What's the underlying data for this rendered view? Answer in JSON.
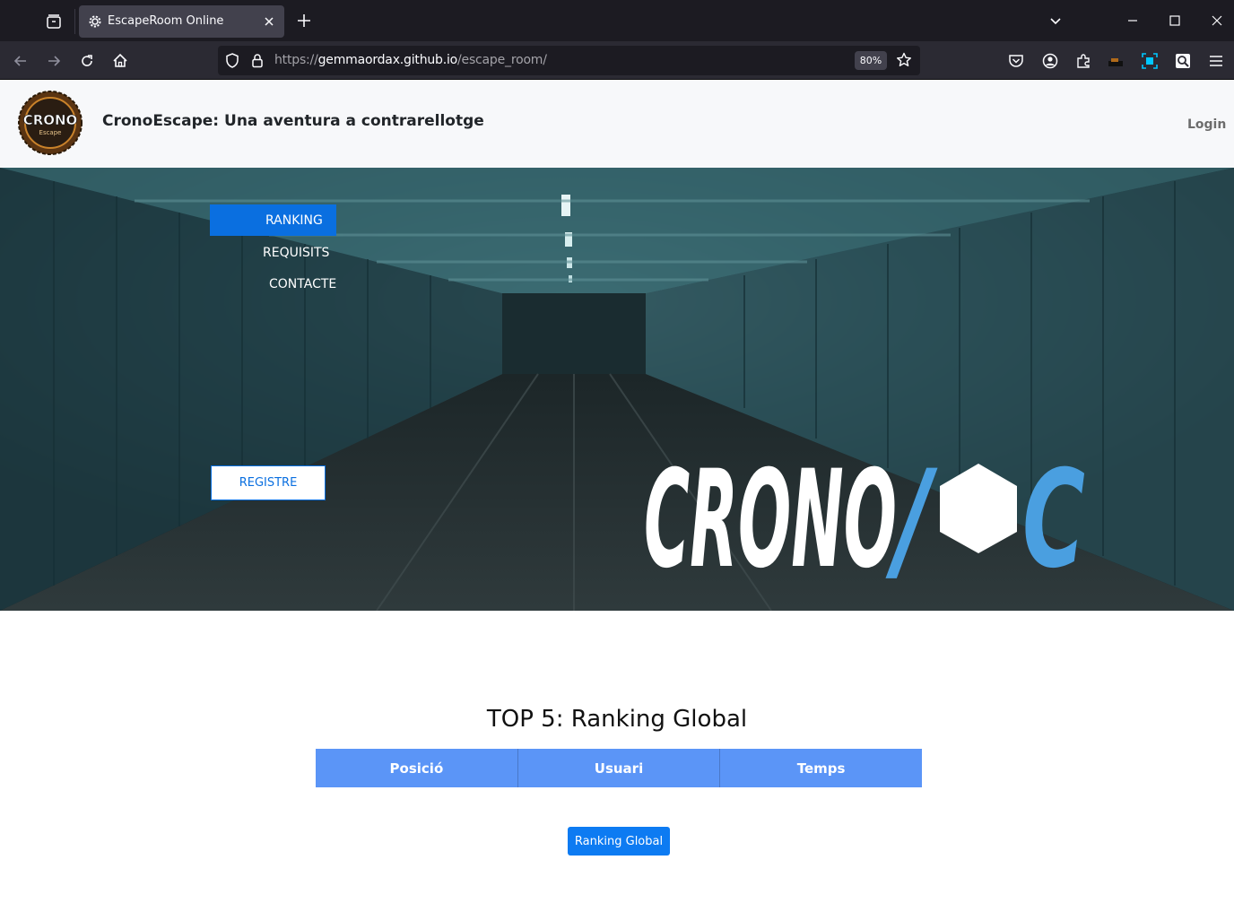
{
  "browser": {
    "tab": {
      "title": "EscapeRoom Online",
      "favicon": "gear-icon"
    },
    "url": {
      "scheme": "https://",
      "host": "gemmaordax.github.io",
      "path": "/escape_room/"
    },
    "zoom": "80%",
    "icons": [
      "tab-list-icon",
      "close-icon",
      "plus-icon",
      "chevron-down-icon",
      "minimize-icon",
      "maximize-icon",
      "window-close-icon",
      "back-icon",
      "forward-icon",
      "reload-icon",
      "home-icon",
      "shield-icon",
      "lock-icon",
      "star-icon",
      "pocket-icon",
      "account-icon",
      "extensions-icon",
      "screenshot-icon",
      "menu-icon"
    ]
  },
  "header": {
    "logo_text": "CRONO",
    "logo_sub": "Escape",
    "title": "CronoEscape: Una aventura a contrarellotge",
    "login": "Login"
  },
  "hero": {
    "menu": [
      {
        "label": "RANKING",
        "active": true
      },
      {
        "label": "REQUISITS",
        "active": false
      },
      {
        "label": "CONTACTE",
        "active": false
      }
    ],
    "register_button": "REGISTRE",
    "brand": {
      "left": "CRONO",
      "slash": "/",
      "right": "C"
    }
  },
  "ranking": {
    "title": "TOP 5: Ranking Global",
    "columns": [
      "Posició",
      "Usuari",
      "Temps"
    ],
    "rows": [],
    "button": "Ranking Global"
  },
  "colors": {
    "primary": "#0a6fe0",
    "table_header": "#5b95f7",
    "header_bg": "#f7f8fa",
    "brand_blue": "#4a9fe0"
  }
}
